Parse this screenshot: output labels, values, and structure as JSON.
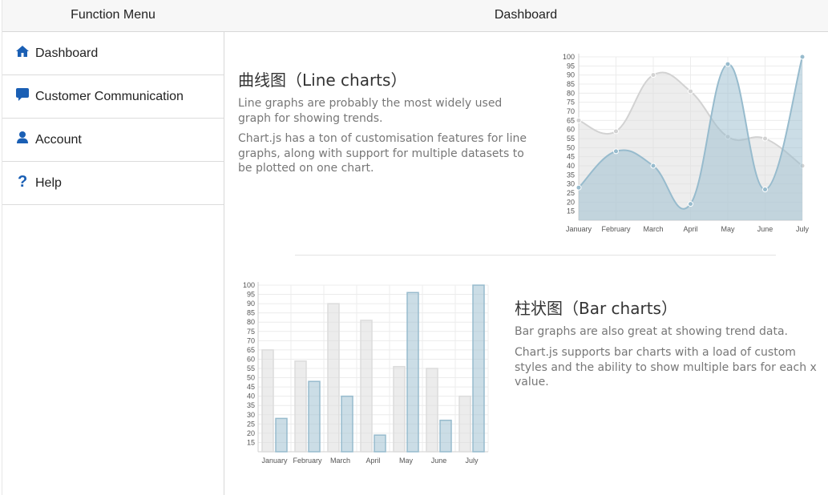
{
  "sidebar": {
    "title": "Function Menu",
    "items": [
      {
        "label": "Dashboard",
        "icon": "home-icon"
      },
      {
        "label": "Customer Communication",
        "icon": "chat-icon"
      },
      {
        "label": "Account",
        "icon": "user-icon"
      },
      {
        "label": "Help",
        "icon": "question-icon"
      }
    ]
  },
  "main": {
    "title": "Dashboard",
    "line_section": {
      "title": "曲线图（Line charts）",
      "p1": "Line graphs are probably the most widely used graph for showing trends.",
      "p2": "Chart.js has a ton of customisation features for line graphs, along with support for multiple datasets to be plotted on one chart."
    },
    "bar_section": {
      "title": "柱状图（Bar charts）",
      "p1": "Bar graphs are also great at showing trend data.",
      "p2": "Chart.js supports bar charts with a load of custom styles and the ability to show multiple bars for each x value."
    }
  },
  "colors": {
    "accent": "#1a5fb4",
    "series1_fill": "rgba(220,220,220,0.5)",
    "series1_stroke": "#d2d2d2",
    "series2_fill": "rgba(151,187,205,0.5)",
    "series2_stroke": "#97bbcd"
  },
  "chart_data": [
    {
      "type": "line",
      "categories": [
        "January",
        "February",
        "March",
        "April",
        "May",
        "June",
        "July"
      ],
      "series": [
        {
          "values": [
            65,
            59,
            90,
            81,
            56,
            55,
            40
          ]
        },
        {
          "values": [
            28,
            48,
            40,
            19,
            96,
            27,
            100
          ]
        }
      ],
      "ylim": [
        10,
        100
      ],
      "yticks": [
        15,
        20,
        25,
        30,
        35,
        40,
        45,
        50,
        55,
        60,
        65,
        70,
        75,
        80,
        85,
        90,
        95,
        100
      ],
      "grid": true
    },
    {
      "type": "bar",
      "categories": [
        "January",
        "February",
        "March",
        "April",
        "May",
        "June",
        "July"
      ],
      "series": [
        {
          "values": [
            65,
            59,
            90,
            81,
            56,
            55,
            40
          ]
        },
        {
          "values": [
            28,
            48,
            40,
            19,
            96,
            27,
            100
          ]
        }
      ],
      "ylim": [
        10,
        100
      ],
      "yticks": [
        15,
        20,
        25,
        30,
        35,
        40,
        45,
        50,
        55,
        60,
        65,
        70,
        75,
        80,
        85,
        90,
        95,
        100
      ],
      "grid": true
    }
  ]
}
